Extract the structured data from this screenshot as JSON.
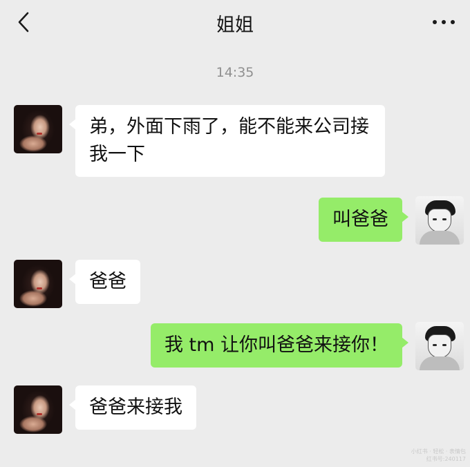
{
  "header": {
    "title": "姐姐",
    "back_icon": "chevron-left-icon",
    "more_icon": "more-dots-icon"
  },
  "timestamp": "14:35",
  "messages": [
    {
      "from": "sister",
      "text": "弟，外面下雨了，能不能来公司接我一下"
    },
    {
      "from": "me",
      "text": "叫爸爸"
    },
    {
      "from": "sister",
      "text": "爸爸"
    },
    {
      "from": "me",
      "text": "我 tm 让你叫爸爸来接你！"
    },
    {
      "from": "sister",
      "text": "爸爸来接我"
    }
  ],
  "watermark": [
    "小红书 · 轻松 · 表情包",
    "红书号:240117"
  ],
  "colors": {
    "background": "#ececec",
    "left_bubble": "#ffffff",
    "right_bubble": "#95ec69"
  }
}
